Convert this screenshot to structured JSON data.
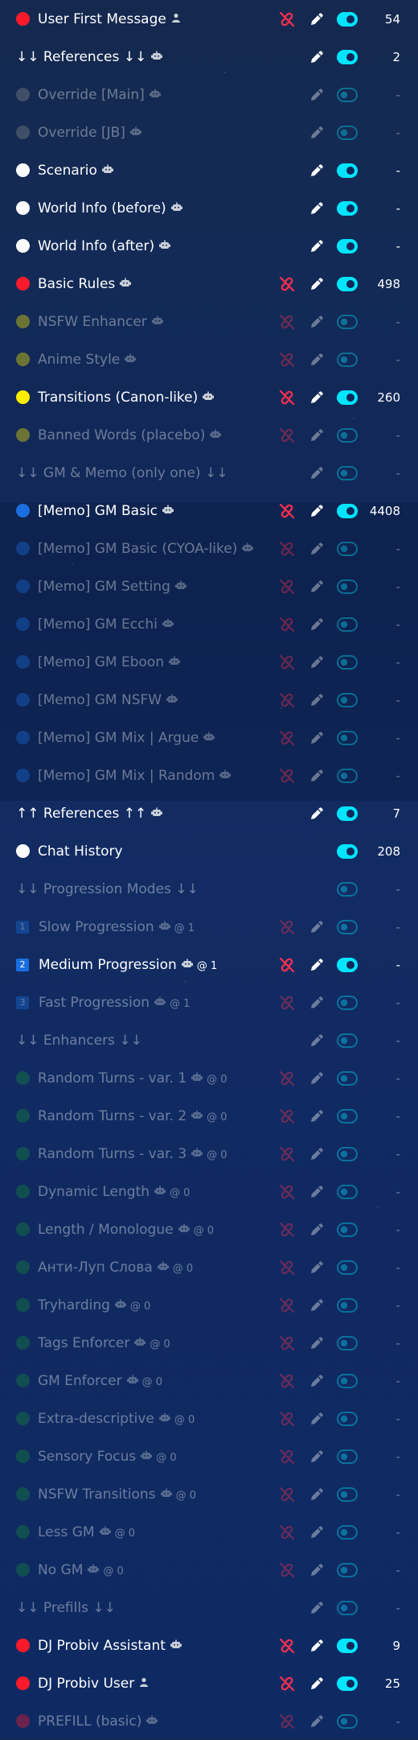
{
  "colors": {
    "red": "#ff1a2b",
    "white": "#ffffff",
    "yellow": "#ffee00",
    "blue": "#1a6fe0",
    "gray": "#8a8a8a",
    "green": "#138a36",
    "teal": "#00e5ff",
    "no_edit_icon": "#ff2f4e"
  },
  "icons": {
    "user_role": "person-icon",
    "assistant_role": "robot-icon",
    "no_edit": "no-edit-icon",
    "edit": "pencil-icon",
    "toggle": "toggle-icon"
  },
  "prompts": [
    {
      "label": "User First Message",
      "dot": "red",
      "role": "user",
      "noedit": true,
      "enabled": true,
      "tokens": "54"
    },
    {
      "label": "↓↓ References ↓↓",
      "dot": null,
      "role": "assistant",
      "noedit": false,
      "enabled": true,
      "tokens": "2"
    },
    {
      "label": "Override [Main]",
      "dot": "gray",
      "role": "assistant",
      "noedit": false,
      "enabled": false,
      "tokens": "-"
    },
    {
      "label": "Override [JB]",
      "dot": "gray",
      "role": "assistant",
      "noedit": false,
      "enabled": false,
      "tokens": "-"
    },
    {
      "label": "Scenario",
      "dot": "white",
      "role": "assistant",
      "noedit": false,
      "enabled": true,
      "tokens": "-"
    },
    {
      "label": "World Info (before)",
      "dot": "white",
      "role": "assistant",
      "noedit": false,
      "enabled": true,
      "tokens": "-"
    },
    {
      "label": "World Info (after)",
      "dot": "white",
      "role": "assistant",
      "noedit": false,
      "enabled": true,
      "tokens": "-"
    },
    {
      "label": "Basic Rules",
      "dot": "red",
      "role": "assistant",
      "noedit": true,
      "enabled": true,
      "tokens": "498"
    },
    {
      "label": "NSFW Enhancer",
      "dot": "yellow",
      "role": "assistant",
      "noedit": true,
      "enabled": false,
      "tokens": "-"
    },
    {
      "label": "Anime Style",
      "dot": "yellow",
      "role": "assistant",
      "noedit": true,
      "enabled": false,
      "tokens": "-"
    },
    {
      "label": "Transitions (Canon-like)",
      "dot": "yellow",
      "role": "assistant",
      "noedit": true,
      "enabled": true,
      "tokens": "260"
    },
    {
      "label": "Banned Words (placebo)",
      "dot": "yellow",
      "role": "assistant",
      "noedit": true,
      "enabled": false,
      "tokens": "-"
    },
    {
      "label": "↓↓ GM & Memo (only one) ↓↓",
      "dot": null,
      "role": null,
      "noedit": false,
      "enabled": false,
      "tokens": "-"
    },
    {
      "label": "[Memo] GM Basic",
      "dot": "blue",
      "role": "assistant",
      "noedit": true,
      "enabled": true,
      "tokens": "4408"
    },
    {
      "label": "[Memo] GM Basic (CYOA-like)",
      "dot": "blue",
      "role": "assistant",
      "noedit": true,
      "enabled": false,
      "tokens": "-"
    },
    {
      "label": "[Memo] GM Setting",
      "dot": "blue",
      "role": "assistant",
      "noedit": true,
      "enabled": false,
      "tokens": "-"
    },
    {
      "label": "[Memo] GM Ecchi",
      "dot": "blue",
      "role": "assistant",
      "noedit": true,
      "enabled": false,
      "tokens": "-"
    },
    {
      "label": "[Memo] GM Eboon",
      "dot": "blue",
      "role": "assistant",
      "noedit": true,
      "enabled": false,
      "tokens": "-"
    },
    {
      "label": "[Memo] GM NSFW",
      "dot": "blue",
      "role": "assistant",
      "noedit": true,
      "enabled": false,
      "tokens": "-"
    },
    {
      "label": "[Memo] GM Mix | Argue",
      "dot": "blue",
      "role": "assistant",
      "noedit": true,
      "enabled": false,
      "tokens": "-"
    },
    {
      "label": "[Memo] GM Mix | Random",
      "dot": "blue",
      "role": "assistant",
      "noedit": true,
      "enabled": false,
      "tokens": "-"
    },
    {
      "label": "↑↑ References ↑↑",
      "dot": null,
      "role": "assistant",
      "noedit": false,
      "enabled": true,
      "tokens": "7"
    },
    {
      "label": "Chat History",
      "dot": "white",
      "role": null,
      "noedit": false,
      "enabled": true,
      "tokens": "208",
      "no_pencil": true
    },
    {
      "label": "↓↓ Progression Modes ↓↓",
      "dot": null,
      "role": null,
      "noedit": false,
      "enabled": false,
      "tokens": "-",
      "no_pencil": true
    },
    {
      "label": "Slow Progression",
      "badge": "1",
      "role": "assistant",
      "depth": "@ 1",
      "noedit": true,
      "enabled": false,
      "tokens": "-"
    },
    {
      "label": "Medium Progression",
      "badge": "2",
      "role": "assistant",
      "depth": "@ 1",
      "noedit": true,
      "enabled": true,
      "tokens": "-"
    },
    {
      "label": "Fast Progression",
      "badge": "3",
      "role": "assistant",
      "depth": "@ 1",
      "noedit": true,
      "enabled": false,
      "tokens": "-"
    },
    {
      "label": "↓↓ Enhancers ↓↓",
      "dot": null,
      "role": null,
      "noedit": false,
      "enabled": false,
      "tokens": "-"
    },
    {
      "label": "Random Turns - var. 1",
      "dot": "green",
      "role": "assistant",
      "depth": "@ 0",
      "noedit": true,
      "enabled": false,
      "tokens": "-"
    },
    {
      "label": "Random Turns - var. 2",
      "dot": "green",
      "role": "assistant",
      "depth": "@ 0",
      "noedit": true,
      "enabled": false,
      "tokens": "-"
    },
    {
      "label": "Random Turns - var. 3",
      "dot": "green",
      "role": "assistant",
      "depth": "@ 0",
      "noedit": true,
      "enabled": false,
      "tokens": "-"
    },
    {
      "label": "Dynamic Length",
      "dot": "green",
      "role": "assistant",
      "depth": "@ 0",
      "noedit": true,
      "enabled": false,
      "tokens": "-"
    },
    {
      "label": "Length / Monologue",
      "dot": "green",
      "role": "assistant",
      "depth": "@ 0",
      "noedit": true,
      "enabled": false,
      "tokens": "-"
    },
    {
      "label": "Анти-Луп Слова",
      "dot": "green",
      "role": "assistant",
      "depth": "@ 0",
      "noedit": true,
      "enabled": false,
      "tokens": "-"
    },
    {
      "label": "Tryharding",
      "dot": "green",
      "role": "assistant",
      "depth": "@ 0",
      "noedit": true,
      "enabled": false,
      "tokens": "-"
    },
    {
      "label": "Tags Enforcer",
      "dot": "green",
      "role": "assistant",
      "depth": "@ 0",
      "noedit": true,
      "enabled": false,
      "tokens": "-"
    },
    {
      "label": "GM Enforcer",
      "dot": "green",
      "role": "assistant",
      "depth": "@ 0",
      "noedit": true,
      "enabled": false,
      "tokens": "-"
    },
    {
      "label": "Extra-descriptive",
      "dot": "green",
      "role": "assistant",
      "depth": "@ 0",
      "noedit": true,
      "enabled": false,
      "tokens": "-"
    },
    {
      "label": "Sensory Focus",
      "dot": "green",
      "role": "assistant",
      "depth": "@ 0",
      "noedit": true,
      "enabled": false,
      "tokens": "-"
    },
    {
      "label": "NSFW Transitions",
      "dot": "green",
      "role": "assistant",
      "depth": "@ 0",
      "noedit": true,
      "enabled": false,
      "tokens": "-"
    },
    {
      "label": "Less GM",
      "dot": "green",
      "role": "assistant",
      "depth": "@ 0",
      "noedit": true,
      "enabled": false,
      "tokens": "-"
    },
    {
      "label": "No GM",
      "dot": "green",
      "role": "assistant",
      "depth": "@ 0",
      "noedit": true,
      "enabled": false,
      "tokens": "-"
    },
    {
      "label": "↓↓ Prefills ↓↓",
      "dot": null,
      "role": null,
      "noedit": false,
      "enabled": false,
      "tokens": "-"
    },
    {
      "label": "DJ Probiv Assistant",
      "dot": "red",
      "role": "assistant",
      "noedit": true,
      "enabled": true,
      "tokens": "9"
    },
    {
      "label": "DJ Probiv User",
      "dot": "red",
      "role": "user",
      "noedit": true,
      "enabled": true,
      "tokens": "25"
    },
    {
      "label": "PREFILL (basic)",
      "dot": "red",
      "role": "assistant",
      "noedit": true,
      "enabled": false,
      "tokens": "-"
    }
  ]
}
